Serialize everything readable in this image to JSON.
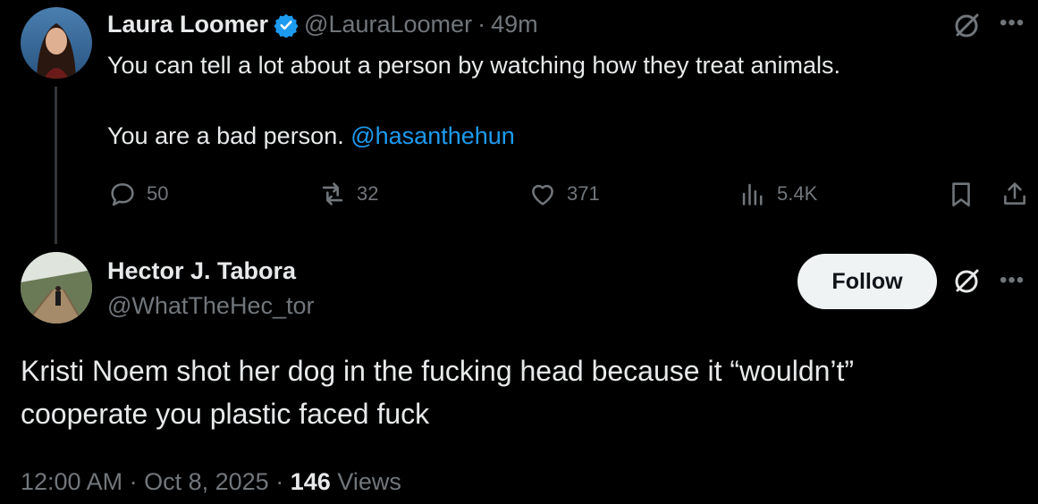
{
  "tweet": {
    "author_name": "Laura Loomer",
    "handle": "@LauraLoomer",
    "separator": "·",
    "time": "49m",
    "line1": "You can tell a lot about a person by watching how they treat animals.",
    "line2": "You are a bad person.",
    "mention": "@hasanthehun",
    "stats": {
      "replies": "50",
      "reposts": "32",
      "likes": "371",
      "views": "5.4K"
    }
  },
  "reply": {
    "author_name": "Hector J. Tabora",
    "handle": "@WhatTheHec_tor",
    "follow_label": "Follow",
    "text_line1": "Kristi Noem shot her dog in the fucking head because it “wouldn’t”",
    "text_line2": "cooperate you plastic faced fuck",
    "time": "12:00 AM",
    "date": "Oct 8, 2025",
    "views_count": "146",
    "views_label": "Views",
    "separator": "·"
  },
  "icons": {
    "more": "more-icon",
    "grok": "grok-icon",
    "verified": "verified-badge-icon"
  },
  "colors": {
    "background": "#000000",
    "text": "#e7e9ea",
    "muted": "#71767b",
    "link": "#1d9bf0",
    "verified": "#1d9bf0"
  }
}
